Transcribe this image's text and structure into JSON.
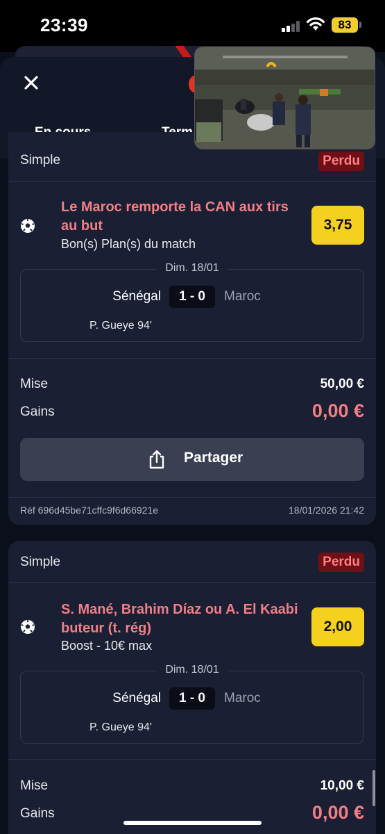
{
  "status_bar": {
    "time": "23:39",
    "battery": "83"
  },
  "header": {
    "tabs": [
      {
        "label": "En cours"
      },
      {
        "label": "Terminés"
      }
    ],
    "active_tab_visible_label": "Term"
  },
  "bets": [
    {
      "type": "Simple",
      "status": "Perdu",
      "selection": "Le Maroc remporte la CAN aux tirs au but",
      "market": "Bon(s) Plan(s) du match",
      "odds": "3,75",
      "match": {
        "date": "Dim. 18/01",
        "home": "Sénégal",
        "score": "1 - 0",
        "away": "Maroc",
        "scorer": "P. Gueye 94'"
      },
      "stake_label": "Mise",
      "stake": "50,00 €",
      "gains_label": "Gains",
      "gains": "0,00 €",
      "share_label": "Partager",
      "ref": "Réf 696d45be71cffc9f6d66921e",
      "datetime": "18/01/2026 21:42"
    },
    {
      "type": "Simple",
      "status": "Perdu",
      "selection": "S. Mané, Brahim Díaz ou A. El Kaabi buteur (t. rég)",
      "market": "Boost - 10€ max",
      "odds": "2,00",
      "match": {
        "date": "Dim. 18/01",
        "home": "Sénégal",
        "score": "1 - 0",
        "away": "Maroc",
        "scorer": "P. Gueye 94'"
      },
      "stake_label": "Mise",
      "stake": "10,00 €",
      "gains_label": "Gains",
      "gains": "0,00 €"
    }
  ],
  "colors": {
    "background": "#0b0f1c",
    "card": "#1a1f33",
    "lost_badge_bg": "#6e1016",
    "lost_text": "#f27e86",
    "odds_yellow": "#f5d11f",
    "share_button": "#3a3f51"
  },
  "icons": [
    "close-icon",
    "soccer-ball-icon",
    "share-icon",
    "wifi-icon",
    "signal-icon",
    "battery-icon"
  ]
}
